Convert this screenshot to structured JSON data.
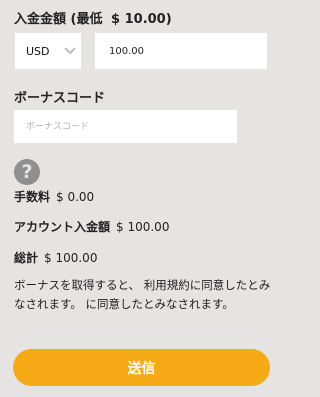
{
  "deposit_heading": {
    "label": "入金金額",
    "min_text": "(最低",
    "min_amount": "$ 10.00)"
  },
  "currency_select": {
    "value": "USD",
    "icon": "chevron-down-icon"
  },
  "amount_input": {
    "value": "100.00"
  },
  "bonus": {
    "label": "ボーナスコード",
    "placeholder": "ボーナスコード"
  },
  "help": {
    "icon": "question-circle-icon",
    "glyph": "?"
  },
  "summary": {
    "fee_label": "手数料",
    "fee_value": "$ 0.00",
    "deposit_label": "アカウント入金額",
    "deposit_value": "$ 100.00",
    "total_label": "総計",
    "total_value": "$ 100.00"
  },
  "notice": {
    "text": "ボーナスを取得すると、 利用規約に同意したとみなされます。 に同意したとみなされます。"
  },
  "submit": {
    "label": "送信",
    "color": "#f6aa15"
  }
}
